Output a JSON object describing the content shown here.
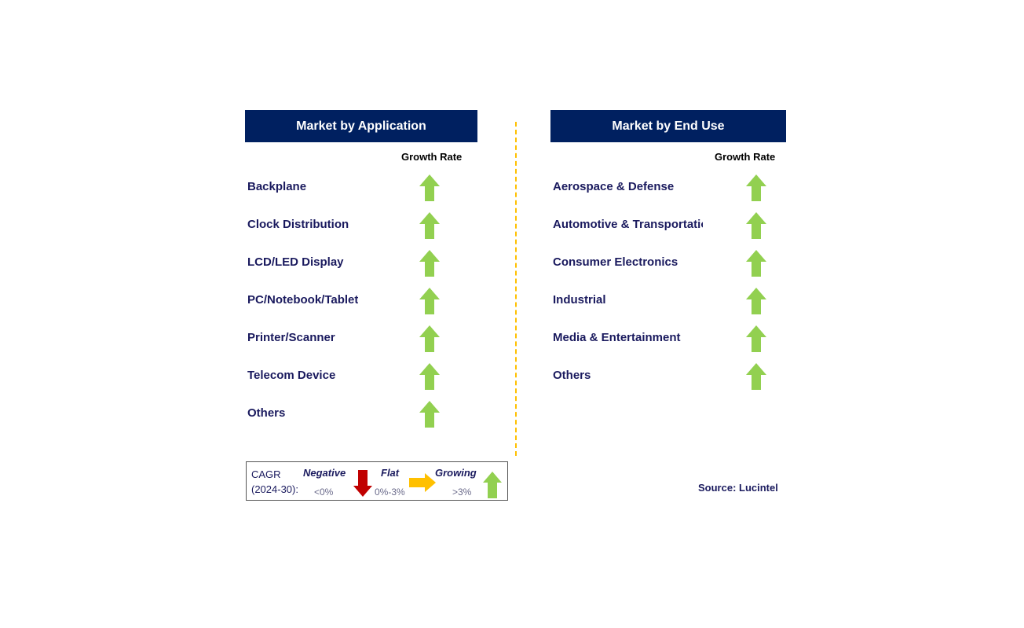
{
  "application": {
    "title": "Market by Application",
    "growth_label": "Growth Rate",
    "items": [
      {
        "label": "Backplane",
        "trend": "growing"
      },
      {
        "label": "Clock Distribution",
        "trend": "growing"
      },
      {
        "label": "LCD/LED Display",
        "trend": "growing"
      },
      {
        "label": "PC/Notebook/Tablet",
        "trend": "growing"
      },
      {
        "label": "Printer/Scanner",
        "trend": "growing"
      },
      {
        "label": "Telecom Device",
        "trend": "growing"
      },
      {
        "label": "Others",
        "trend": "growing"
      }
    ]
  },
  "end_use": {
    "title": "Market by End Use",
    "growth_label": "Growth Rate",
    "items": [
      {
        "label": "Aerospace & Defense",
        "trend": "growing"
      },
      {
        "label": "Automotive & Transportation",
        "trend": "growing"
      },
      {
        "label": "Consumer Electronics",
        "trend": "growing"
      },
      {
        "label": "Industrial",
        "trend": "growing"
      },
      {
        "label": "Media & Entertainment",
        "trend": "growing"
      },
      {
        "label": "Others",
        "trend": "growing"
      }
    ]
  },
  "legend": {
    "cagr": "CAGR",
    "period": "(2024-30):",
    "negative": "Negative",
    "negative_range": "<0%",
    "flat": "Flat",
    "flat_range": "0%-3%",
    "growing": "Growing",
    "growing_range": ">3%"
  },
  "source": "Source: Lucintel",
  "colors": {
    "header": "#002060",
    "growing": "#92D050",
    "negative": "#C00000",
    "flat": "#FFC000",
    "divider": "#FFC000"
  }
}
